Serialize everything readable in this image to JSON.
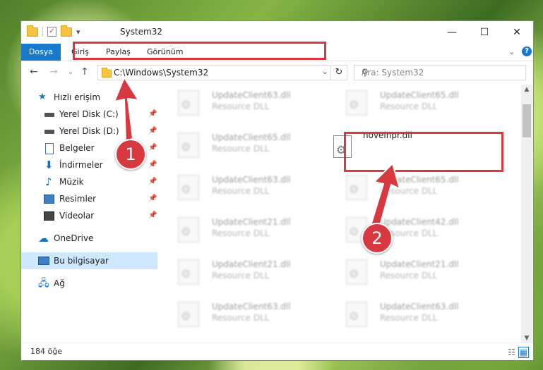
{
  "window": {
    "title": "System32",
    "controls": {
      "minimize": "—",
      "maximize": "☐",
      "close": "✕"
    }
  },
  "ribbon": {
    "tabs": [
      "Dosya",
      "Giriş",
      "Paylaş",
      "Görünüm"
    ],
    "help": "?",
    "expand": "⌄"
  },
  "addressbar": {
    "path": "C:\\Windows\\System32",
    "search_placeholder": "Ara: System32"
  },
  "sidebar": {
    "items": [
      {
        "label": "Hızlı erişim",
        "icon": "star-icon",
        "pinned": false
      },
      {
        "label": "Yerel Disk (C:)",
        "icon": "drive-icon",
        "pinned": true
      },
      {
        "label": "Yerel Disk (D:)",
        "icon": "drive-icon",
        "pinned": true
      },
      {
        "label": "Belgeler",
        "icon": "documents-icon",
        "pinned": true
      },
      {
        "label": "İndirmeler",
        "icon": "download-icon",
        "pinned": true
      },
      {
        "label": "Müzik",
        "icon": "music-icon",
        "pinned": true
      },
      {
        "label": "Resimler",
        "icon": "pictures-icon",
        "pinned": true
      },
      {
        "label": "Videolar",
        "icon": "videos-icon",
        "pinned": true
      },
      {
        "label": "OneDrive",
        "icon": "cloud-icon",
        "pinned": false
      },
      {
        "label": "Bu bilgisayar",
        "icon": "computer-icon",
        "pinned": false,
        "selected": true
      },
      {
        "label": "Ağ",
        "icon": "network-icon",
        "pinned": false
      }
    ]
  },
  "files": [
    {
      "name": "UpdateClient63.dll",
      "type": "Resource DLL"
    },
    {
      "name": "UpdateClient65.dll",
      "type": "Resource DLL"
    },
    {
      "name": "UpdateClient65.dll",
      "type": "Resource DLL"
    },
    {
      "name": "novelnpr.dll",
      "type": "",
      "highlighted": true
    },
    {
      "name": "UpdateClient63.dll",
      "type": "Resource DLL"
    },
    {
      "name": "UpdateClient65.dll",
      "type": "Resource DLL"
    },
    {
      "name": "UpdateClient21.dll",
      "type": "Resource DLL"
    },
    {
      "name": "UpdateClient42.dll",
      "type": "Resource DLL"
    },
    {
      "name": "UpdateClient21.dll",
      "type": "Resource DLL"
    },
    {
      "name": "UpdateClient21.dll",
      "type": "Resource DLL"
    },
    {
      "name": "UpdateClient63.dll",
      "type": "Resource DLL"
    },
    {
      "name": "UpdateClient63.dll",
      "type": "Resource DLL"
    }
  ],
  "status": {
    "item_count": "184 öğe"
  },
  "annotations": {
    "step1": "1",
    "step2": "2"
  },
  "colors": {
    "accent": "#1979ca",
    "highlight": "#d8383f",
    "selected": "#cde8ff"
  }
}
